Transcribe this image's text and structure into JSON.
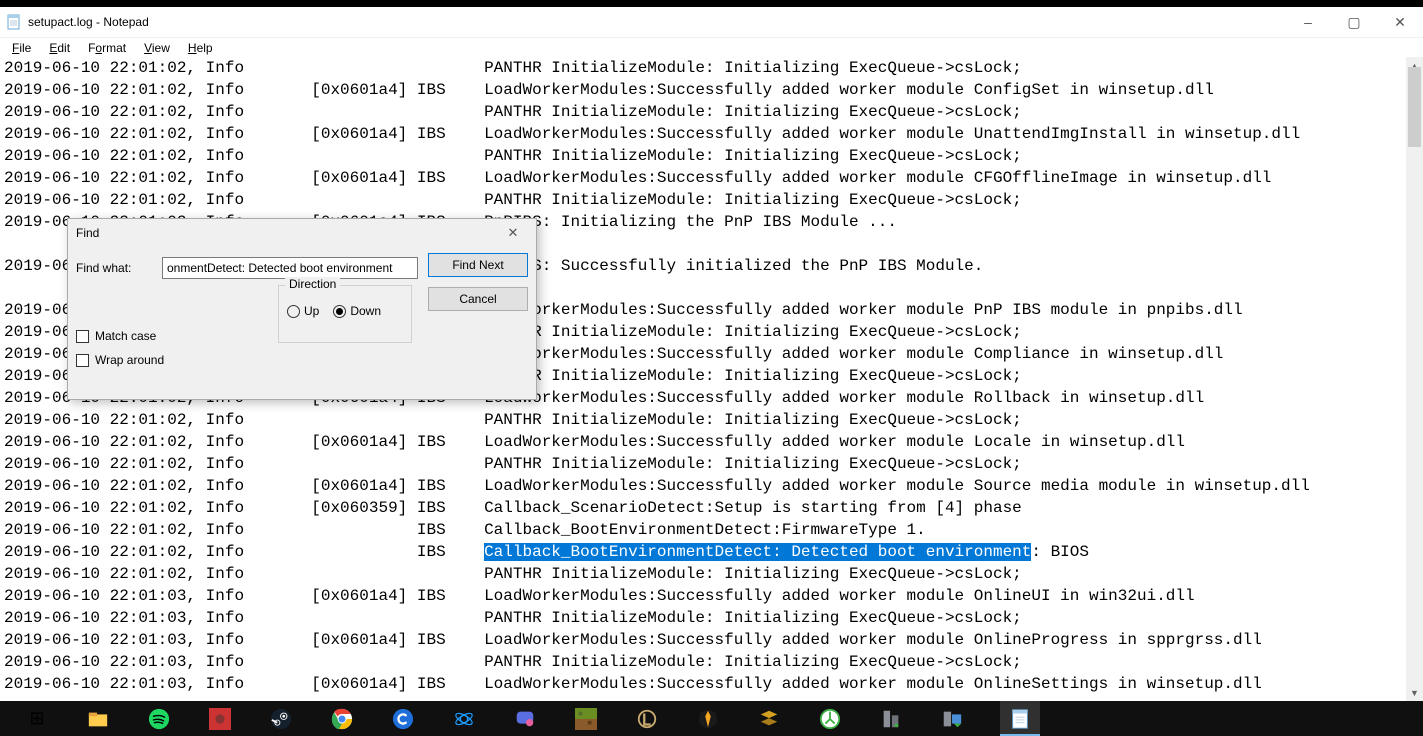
{
  "window": {
    "title": "setupact.log - Notepad",
    "buttons": {
      "minimize": "–",
      "maximize": "▢",
      "close": "✕"
    }
  },
  "menubar": {
    "items": [
      {
        "hotkey": "F",
        "rest": "ile"
      },
      {
        "hotkey": "E",
        "rest": "dit"
      },
      {
        "hotkey": "o",
        "prefix": "F",
        "rest": "rmat"
      },
      {
        "hotkey": "V",
        "rest": "iew"
      },
      {
        "hotkey": "H",
        "rest": "elp"
      }
    ]
  },
  "log_lines": [
    {
      "text": "2019-06-10 22:01:02, Info                         PANTHR InitializeModule: Initializing ExecQueue->csLock;"
    },
    {
      "text": "2019-06-10 22:01:02, Info       [0x0601a4] IBS    LoadWorkerModules:Successfully added worker module ConfigSet in winsetup.dll"
    },
    {
      "text": "2019-06-10 22:01:02, Info                         PANTHR InitializeModule: Initializing ExecQueue->csLock;"
    },
    {
      "text": "2019-06-10 22:01:02, Info       [0x0601a4] IBS    LoadWorkerModules:Successfully added worker module UnattendImgInstall in winsetup.dll"
    },
    {
      "text": "2019-06-10 22:01:02, Info                         PANTHR InitializeModule: Initializing ExecQueue->csLock;"
    },
    {
      "text": "2019-06-10 22:01:02, Info       [0x0601a4] IBS    LoadWorkerModules:Successfully added worker module CFGOfflineImage in winsetup.dll"
    },
    {
      "text": "2019-06-10 22:01:02, Info                         PANTHR InitializeModule: Initializing ExecQueue->csLock;"
    },
    {
      "text": "2019-06-10 22:01:02, Info       [0x0601a4] IBS    PnPIBS: Initializing the PnP IBS Module ..."
    },
    {
      "text": ""
    },
    {
      "text": "2019-06-10 22:01:02, Info       [0x0601a4] IBS    PnPIBS: Successfully initialized the PnP IBS Module."
    },
    {
      "text": ""
    },
    {
      "text": "2019-06-10 22:01:02, Info       [0x0601a4] IBS    LoadWorkerModules:Successfully added worker module PnP IBS module in pnpibs.dll"
    },
    {
      "text": "2019-06-10 22:01:02, Info                         PANTHR InitializeModule: Initializing ExecQueue->csLock;"
    },
    {
      "text": "2019-06-10 22:01:02, Info       [0x0601a4] IBS    LoadWorkerModules:Successfully added worker module Compliance in winsetup.dll"
    },
    {
      "text": "2019-06-10 22:01:02, Info                         PANTHR InitializeModule: Initializing ExecQueue->csLock;"
    },
    {
      "text": "2019-06-10 22:01:02, Info       [0x0601a4] IBS    LoadWorkerModules:Successfully added worker module Rollback in winsetup.dll"
    },
    {
      "text": "2019-06-10 22:01:02, Info                         PANTHR InitializeModule: Initializing ExecQueue->csLock;"
    },
    {
      "text": "2019-06-10 22:01:02, Info       [0x0601a4] IBS    LoadWorkerModules:Successfully added worker module Locale in winsetup.dll"
    },
    {
      "text": "2019-06-10 22:01:02, Info                         PANTHR InitializeModule: Initializing ExecQueue->csLock;"
    },
    {
      "text": "2019-06-10 22:01:02, Info       [0x0601a4] IBS    LoadWorkerModules:Successfully added worker module Source media module in winsetup.dll"
    },
    {
      "text": "2019-06-10 22:01:02, Info       [0x060359] IBS    Callback_ScenarioDetect:Setup is starting from [4] phase"
    },
    {
      "text": "2019-06-10 22:01:02, Info                  IBS    Callback_BootEnvironmentDetect:FirmwareType 1."
    },
    {
      "pre": "2019-06-10 22:01:02, Info                  IBS    ",
      "sel": "Callback_BootEnvironmentDetect: Detected boot environment",
      "post": ": BIOS"
    },
    {
      "text": "2019-06-10 22:01:02, Info                         PANTHR InitializeModule: Initializing ExecQueue->csLock;"
    },
    {
      "text": "2019-06-10 22:01:03, Info       [0x0601a4] IBS    LoadWorkerModules:Successfully added worker module OnlineUI in win32ui.dll"
    },
    {
      "text": "2019-06-10 22:01:03, Info                         PANTHR InitializeModule: Initializing ExecQueue->csLock;"
    },
    {
      "text": "2019-06-10 22:01:03, Info       [0x0601a4] IBS    LoadWorkerModules:Successfully added worker module OnlineProgress in spprgrss.dll"
    },
    {
      "text": "2019-06-10 22:01:03, Info                         PANTHR InitializeModule: Initializing ExecQueue->csLock;"
    },
    {
      "text": "2019-06-10 22:01:03, Info       [0x0601a4] IBS    LoadWorkerModules:Successfully added worker module OnlineSettings in winsetup.dll"
    }
  ],
  "find_dialog": {
    "title": "Find",
    "close": "✕",
    "label_find_what": "Find what:",
    "input_value": "onmentDetect: Detected boot environment",
    "btn_find_next": "Find Next",
    "btn_cancel": "Cancel",
    "direction_label": "Direction",
    "up_label": "Up",
    "down_label": "Down",
    "direction_selected": "down",
    "match_case_label": "Match case",
    "wrap_around_label": "Wrap around"
  },
  "taskbar_icons": [
    {
      "name": "task-view-icon",
      "glyph": "⊞"
    },
    {
      "name": "file-explorer-icon",
      "svg": "explorer"
    },
    {
      "name": "spotify-icon",
      "svg": "spotify"
    },
    {
      "name": "app-red-icon",
      "svg": "redbox"
    },
    {
      "name": "steam-icon",
      "svg": "steam"
    },
    {
      "name": "chrome-icon",
      "svg": "chrome"
    },
    {
      "name": "app-blue-c-icon",
      "svg": "bluec"
    },
    {
      "name": "battlenet-icon",
      "svg": "bnet"
    },
    {
      "name": "messenger-icon",
      "svg": "msgr"
    },
    {
      "name": "minecraft-icon",
      "svg": "mc"
    },
    {
      "name": "league-icon",
      "svg": "lol"
    },
    {
      "name": "app-orange-icon",
      "svg": "orange"
    },
    {
      "name": "app-stack-icon",
      "svg": "stack"
    },
    {
      "name": "app-green-circle-icon",
      "svg": "greenc"
    },
    {
      "name": "server-icon",
      "svg": "srv1"
    },
    {
      "name": "server2-icon",
      "svg": "srv2"
    },
    {
      "name": "notepad-icon",
      "svg": "notepad",
      "active": true
    }
  ]
}
